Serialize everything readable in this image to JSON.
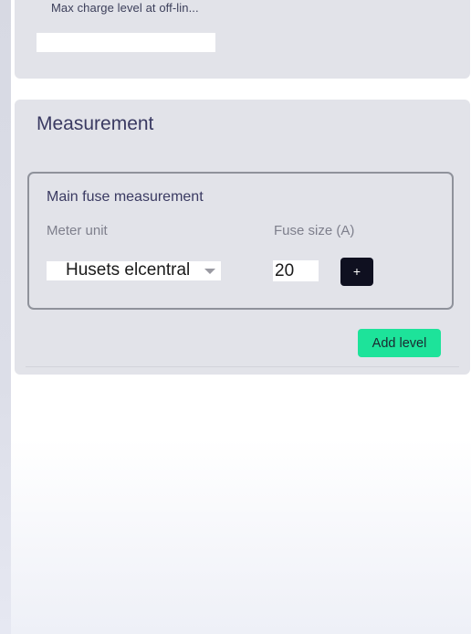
{
  "charging": {
    "max_charge_label": "Max charge level at off-lin...",
    "max_charge_value": ""
  },
  "measurement": {
    "title": "Measurement",
    "main_fuse": {
      "title": "Main fuse measurement",
      "meter_unit_label": "Meter unit",
      "meter_unit_value": "Husets elcentral",
      "fuse_size_label": "Fuse size (A)",
      "fuse_size_value": "20",
      "plus_label": "+"
    },
    "add_level_label": "Add level"
  },
  "icons": {
    "select_chevron": "chevron-down-icon"
  },
  "colors": {
    "card_background": "#e2e3e9",
    "title_text": "#3a3a62",
    "plus_button": "#0f1020",
    "add_level_button": "#1de39a"
  }
}
